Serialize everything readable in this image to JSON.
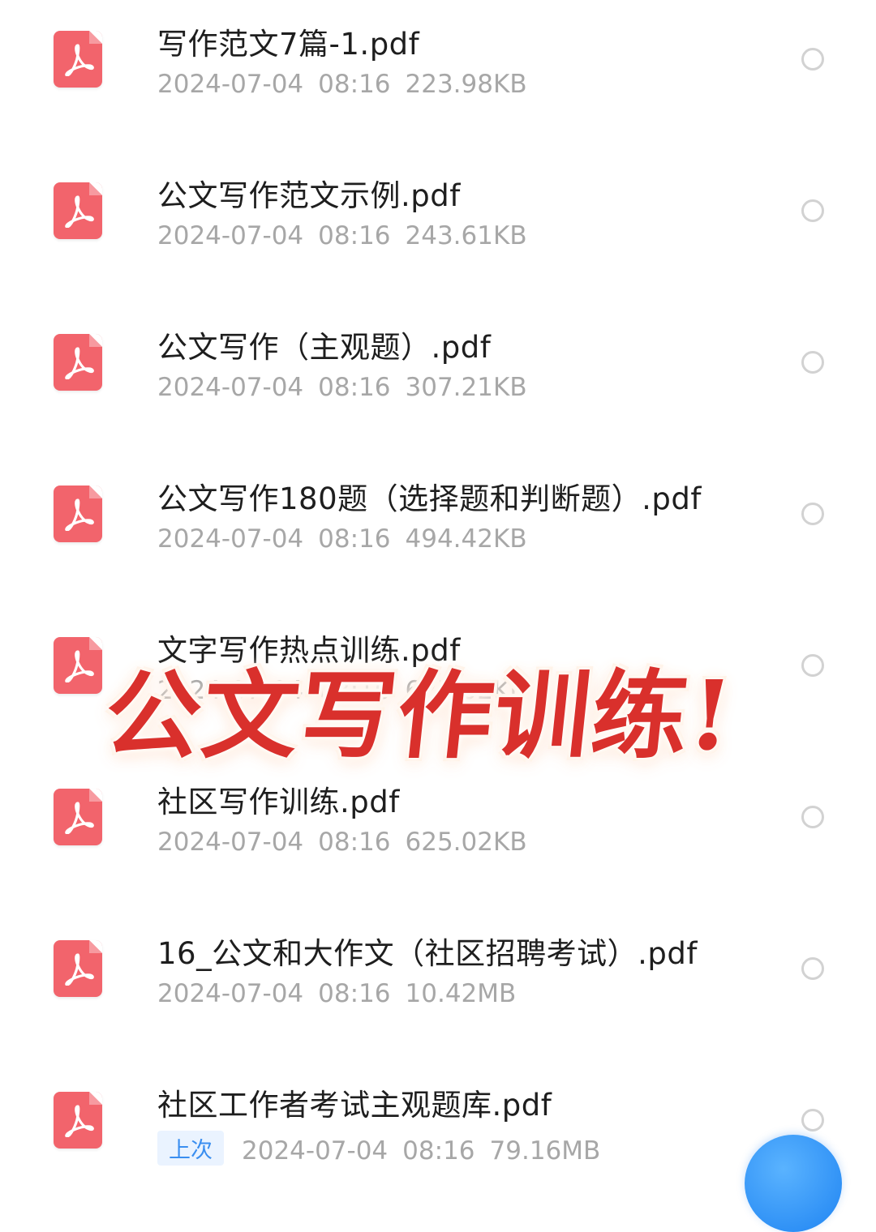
{
  "files": [
    {
      "name": "写作范文7篇-1.pdf",
      "date": "2024-07-04",
      "time": "08:16",
      "size": "223.98KB"
    },
    {
      "name": "公文写作范文示例.pdf",
      "date": "2024-07-04",
      "time": "08:16",
      "size": "243.61KB"
    },
    {
      "name": "公文写作（主观题）.pdf",
      "date": "2024-07-04",
      "time": "08:16",
      "size": "307.21KB"
    },
    {
      "name": "公文写作180题（选择题和判断题）.pdf",
      "date": "2024-07-04",
      "time": "08:16",
      "size": "494.42KB"
    },
    {
      "name": "文字写作热点训练.pdf",
      "date": "2024-07-04",
      "time": "08:16",
      "size": "625.02KB"
    },
    {
      "name": "社区写作训练.pdf",
      "date": "2024-07-04",
      "time": "08:16",
      "size": "625.02KB"
    },
    {
      "name": "16_公文和大作文（社区招聘考试）.pdf",
      "date": "2024-07-04",
      "time": "08:16",
      "size": "10.42MB"
    },
    {
      "name": "社区工作者考试主观题库.pdf",
      "date": "2024-07-04",
      "time": "08:16",
      "size": "79.16MB",
      "badge": "上次"
    }
  ],
  "overlay": {
    "title": "公文写作训练!"
  },
  "colors": {
    "pdf_icon": "#f2646c",
    "badge_text": "#3a8ef0",
    "overlay_text": "#d9302c",
    "fab": "#1f84f2"
  },
  "icons": {
    "file_icon": "pdf-file-icon",
    "select": "radio-circle-icon"
  }
}
